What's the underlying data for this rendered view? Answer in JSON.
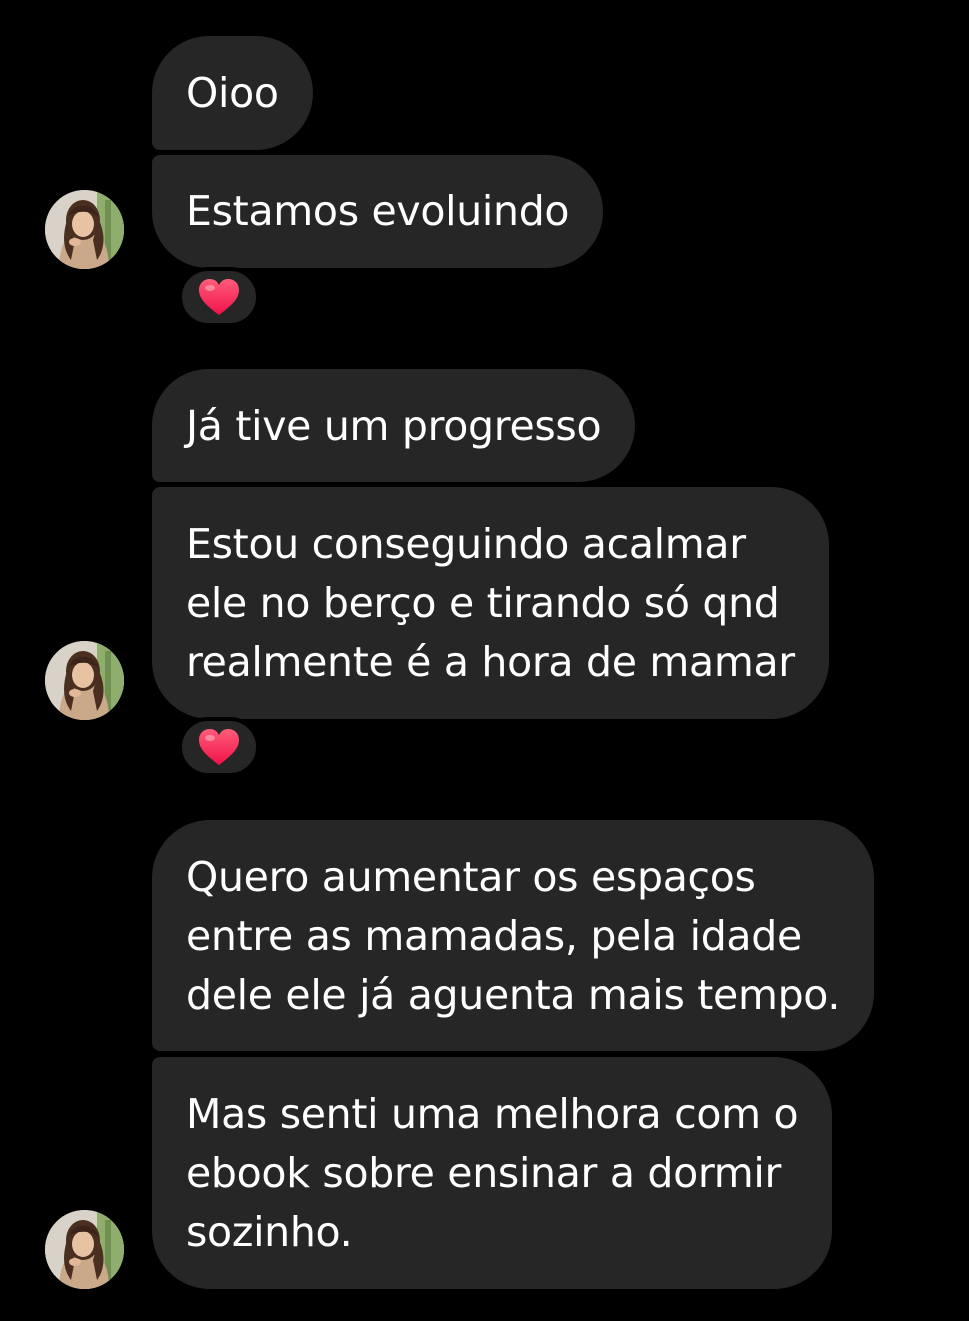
{
  "conversation": {
    "messages": [
      {
        "text": "Oioo"
      },
      {
        "text": "Estamos evoluindo",
        "reaction": "heart"
      },
      {
        "text": "Já tive um progresso"
      },
      {
        "text": "Estou conseguindo acalmar\nele no berço e tirando só qnd\nrealmente é a hora de mamar",
        "reaction": "heart"
      },
      {
        "text": "Quero aumentar os espaços\nentre as mamadas, pela idade\ndele ele já aguenta mais tempo."
      },
      {
        "text": "Mas senti uma melhora com o\nebook sobre ensinar a dormir\nsozinho."
      }
    ]
  },
  "colors": {
    "background": "#000000",
    "bubble": "#262626",
    "text": "#ffffff",
    "reaction_heart": "#ff2d55"
  },
  "icons": {
    "reaction": "heart-emoji-icon",
    "avatar": "contact-avatar"
  }
}
